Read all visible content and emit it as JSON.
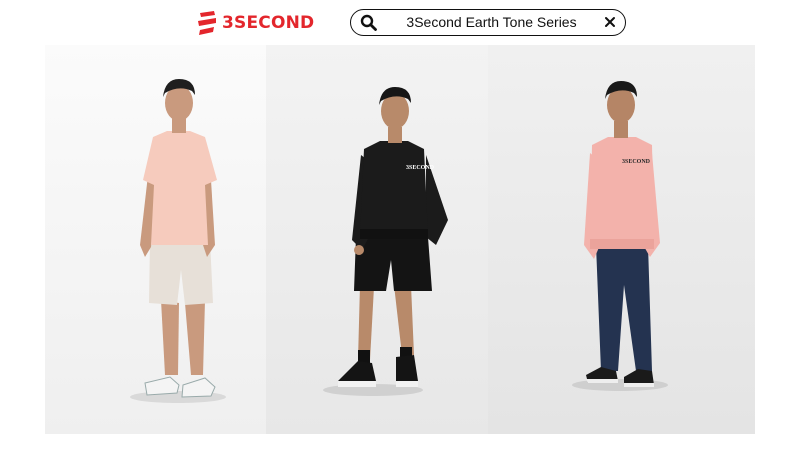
{
  "brand": {
    "logo_text": "3SECOND",
    "logo_color": "#e3262c"
  },
  "search": {
    "value": "3Second Earth Tone Series",
    "search_icon": "search-icon",
    "clear_icon": "close-icon"
  },
  "products": [
    {
      "description": "Model wearing pink t-shirt and beige shorts",
      "top_color": "#f6cbbd",
      "bottom_color": "#e7e0d8"
    },
    {
      "description": "Model wearing black sweatshirt and black shorts",
      "top_color": "#1b1b1b",
      "bottom_color": "#141414",
      "print_text": "3SECOND"
    },
    {
      "description": "Model wearing pink sweatshirt and blue jeans",
      "top_color": "#f3b2ab",
      "bottom_color": "#243350",
      "print_text": "3SECOND"
    }
  ]
}
